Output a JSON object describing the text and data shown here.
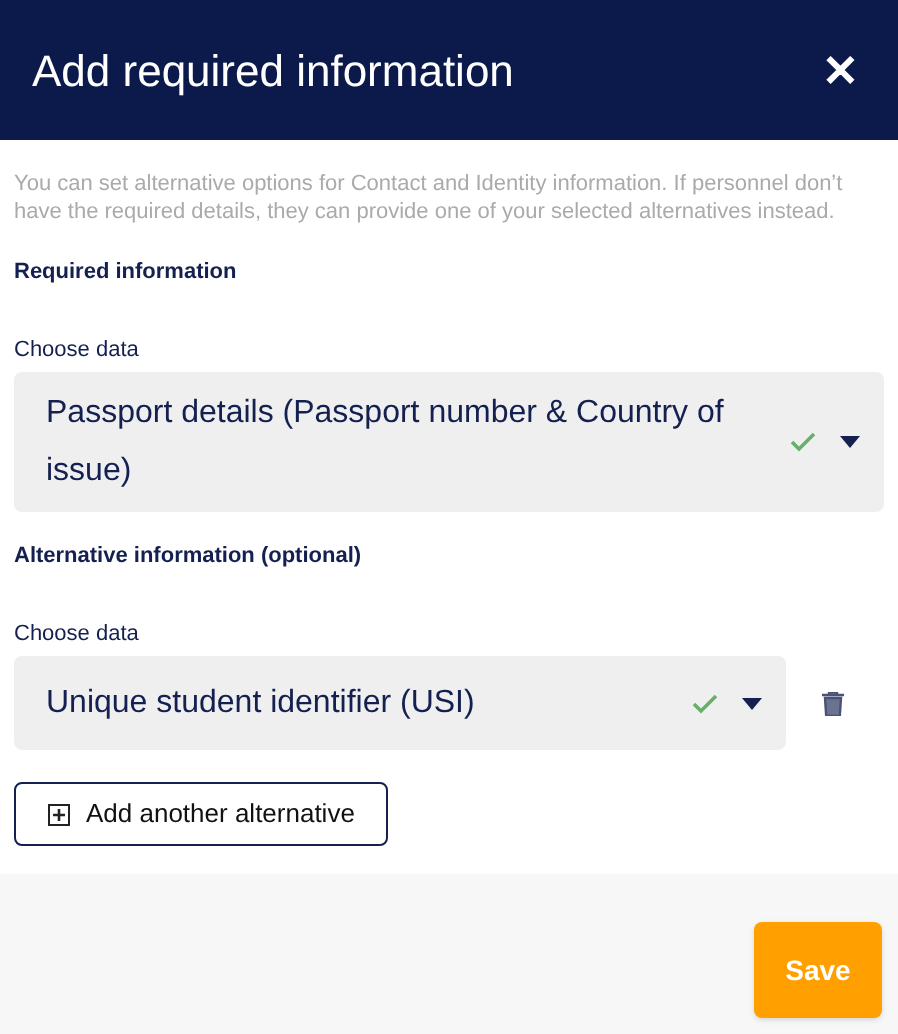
{
  "header": {
    "title": "Add required information",
    "close": "✕"
  },
  "intro": "You can set alternative options for Contact and Identity information. If personnel don’t have the required details, they can provide one of your selected alternatives instead.",
  "required": {
    "heading": "Required information",
    "label": "Choose data",
    "value": "Passport details (Passport number & Country of issue)",
    "valid": true
  },
  "alternative": {
    "heading": "Alternative information (optional)",
    "items": [
      {
        "label": "Choose data",
        "value": "Unique student identifier (USI)",
        "valid": true
      }
    ],
    "add_button": "Add another alternative"
  },
  "footer": {
    "save": "Save"
  }
}
